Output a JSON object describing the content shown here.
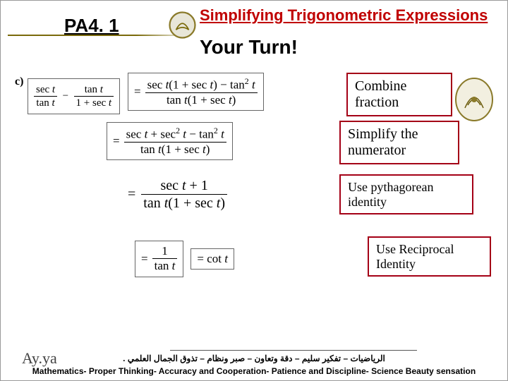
{
  "header": {
    "pa": "PA4. 1",
    "title": "Simplifying Trigonometric Expressions",
    "subtitle": "Your Turn!"
  },
  "problem": {
    "label": "c)",
    "lhs_html": "sec t / tan t − tan t / (1+sec t)"
  },
  "steps": [
    {
      "eq_numer": "sec t(1 + sec t) − tan² t",
      "eq_denom": "tan t(1 + sec t)",
      "note": "Combine fraction"
    },
    {
      "eq_numer": "sec t + sec² t − tan² t",
      "eq_denom": "tan t(1 + sec t)",
      "note": "Simplify the numerator"
    },
    {
      "eq_numer": "sec t + 1",
      "eq_denom": "tan t(1 + sec t)",
      "note": "Use pythagorean identity"
    },
    {
      "eq_numer": "1",
      "eq_denom": "tan t",
      "result": "cot t",
      "note": "Use Reciprocal Identity"
    }
  ],
  "footer": {
    "sig": "Ay.ya",
    "arabic": "الرياضيات – تفكير سليم – دقة وتعاون – صبر ونظام – تذوق الجمال العلمي .",
    "english": "Mathematics- Proper Thinking- Accuracy and Cooperation- Patience and Discipline- Science Beauty sensation"
  }
}
